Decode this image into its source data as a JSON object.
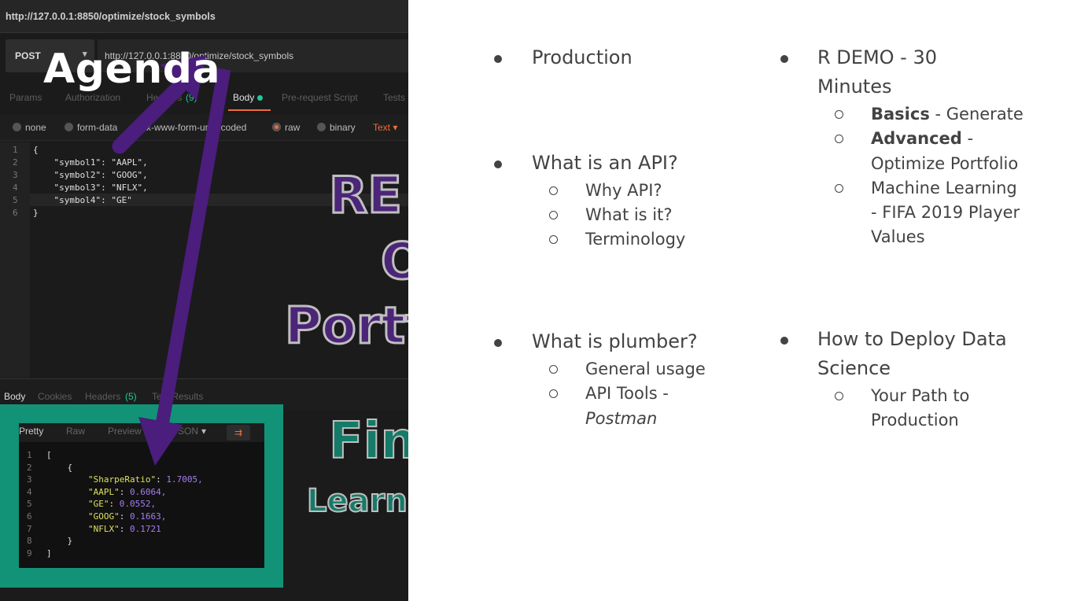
{
  "postman": {
    "top_url": "http://127.0.0.1:8850/optimize/stock_symbols",
    "method": "POST",
    "request_url": "http://127.0.0.1:8850/optimize/stock_symbols",
    "tabs": [
      "Params",
      "Authorization",
      "Headers",
      "(9)",
      "Body",
      "Pre-request Script",
      "Tests"
    ],
    "body_options": [
      "none",
      "form-data",
      "x-www-form-urlencoded",
      "raw",
      "binary",
      "Text"
    ],
    "request_body": [
      "{",
      "    \"symbol1\": \"AAPL\",",
      "    \"symbol2\": \"GOOG\",",
      "    \"symbol3\": \"NFLX\",",
      "    \"symbol4\": \"GE\"",
      "}"
    ],
    "response_tabs": [
      "Body",
      "Cookies",
      "Headers",
      "(5)",
      "Test Results"
    ],
    "response_toolbar": [
      "Pretty",
      "Raw",
      "Preview",
      "JSON"
    ],
    "response_lines": [
      {
        "n": "1",
        "t": "["
      },
      {
        "n": "2",
        "t": "    {"
      },
      {
        "n": "3",
        "k": "\"SharpeRatio\"",
        "v": "1.7005,"
      },
      {
        "n": "4",
        "k": "\"AAPL\"",
        "v": "0.6064,"
      },
      {
        "n": "5",
        "k": "\"GE\"",
        "v": "0.0552,"
      },
      {
        "n": "6",
        "k": "\"GOOG\"",
        "v": "0.1663,"
      },
      {
        "n": "7",
        "k": "\"NFLX\"",
        "v": "0.1721"
      },
      {
        "n": "8",
        "t": "    }"
      },
      {
        "n": "9",
        "t": "]"
      }
    ],
    "overlay_words": [
      "RE",
      "O",
      "Portf",
      "Fin",
      "Learni"
    ]
  },
  "slide": {
    "title": "Agenda",
    "col1": {
      "production": "Production",
      "api": "What is an API?",
      "api_items": [
        "Why API?",
        "What is it?",
        "Terminology"
      ],
      "plumber": "What is plumber?",
      "plumber_item1": "General usage",
      "plumber_item2_bold": "API Tools -",
      "plumber_item2_italic": "Postman"
    },
    "col2": {
      "demo": "R DEMO - 30",
      "demo2": "Minutes",
      "basics_bold": "Basics",
      "basics_rest": " - Generate",
      "advanced_bold": "Advanced",
      "advanced_rest": " -",
      "advanced_line2": "Optimize Portfolio",
      "ml_bold": "Machine Learning",
      "ml_line2": "- FIFA 2019 Player",
      "ml_line3": "Values",
      "deploy1": "How to Deploy Data",
      "deploy2": "Science",
      "path1": "Your Path to",
      "path2": "Production"
    }
  },
  "colors": {
    "accent": "#f26b3a",
    "green_frame": "#129377",
    "arrow": "#4b1d7c",
    "text": "#434343"
  }
}
